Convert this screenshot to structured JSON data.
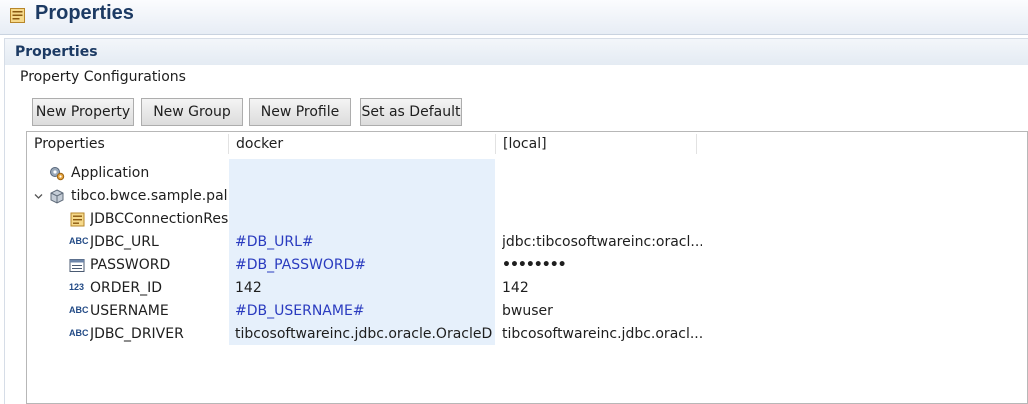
{
  "window": {
    "title": "Properties"
  },
  "section": {
    "title": "Properties",
    "subtitle": "Property Configurations"
  },
  "toolbar": {
    "new_property": "New Property",
    "new_group": "New Group",
    "new_profile": "New Profile",
    "set_default": "Set as Default"
  },
  "table": {
    "headers": [
      "Properties",
      "docker",
      "[local]"
    ],
    "rows": [
      {
        "name": "Application",
        "icon": "application-gear-icon",
        "docker": "",
        "local": ""
      },
      {
        "name": "tibco.bwce.sample.palet",
        "icon": "package-icon",
        "expanded": true,
        "docker": "",
        "local": ""
      },
      {
        "name": "JDBCConnectionResc",
        "icon": "jdbc-resource-icon",
        "docker": "",
        "local": ""
      },
      {
        "name": "JDBC_URL",
        "icon": "string-type-icon",
        "docker": "#DB_URL#",
        "local": "jdbc:tibcosoftwareinc:oracl..."
      },
      {
        "name": "PASSWORD",
        "icon": "password-type-icon",
        "docker": "#DB_PASSWORD#",
        "local": "••••••••"
      },
      {
        "name": "ORDER_ID",
        "icon": "integer-type-icon",
        "docker": "142",
        "local": "142"
      },
      {
        "name": "USERNAME",
        "icon": "string-type-icon",
        "docker": "#DB_USERNAME#",
        "local": "bwuser"
      },
      {
        "name": "JDBC_DRIVER",
        "icon": "string-type-icon",
        "docker": "tibcosoftwareinc.jdbc.oracle.OracleDr...",
        "local": "tibcosoftwareinc.jdbc.oracl..."
      }
    ],
    "type_labels": {
      "string": "ABC",
      "integer": "123"
    }
  },
  "colors": {
    "title": "#1c3a63",
    "docker_column_bg": "#e6f0fb",
    "token_text": "#2a3bbf"
  }
}
